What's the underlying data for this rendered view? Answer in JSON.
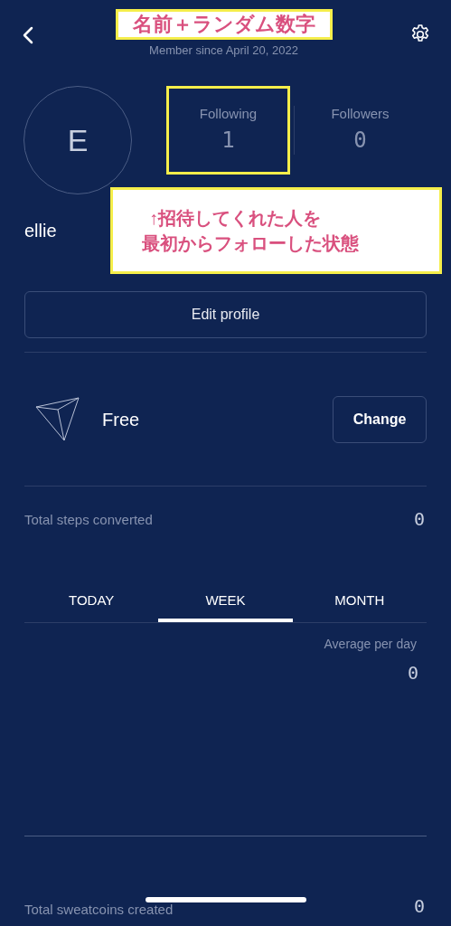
{
  "header": {
    "title_annotation": "名前＋ランダム数字",
    "member_since": "Member since April 20, 2022"
  },
  "profile": {
    "avatar_initial": "E",
    "name": "ellie"
  },
  "stats": [
    {
      "label": "Following",
      "value": "1",
      "highlighted": true
    },
    {
      "label": "Followers",
      "value": "0",
      "highlighted": false
    }
  ],
  "note_annotation": [
    "↑招待してくれた人を",
    "最初からフォローした状態"
  ],
  "edit_button": "Edit profile",
  "plan": {
    "name": "Free",
    "button": "Change"
  },
  "total_steps": {
    "label": "Total steps converted",
    "value": "0"
  },
  "tabs": [
    {
      "label": "TODAY",
      "selected": false
    },
    {
      "label": "WEEK",
      "selected": true
    },
    {
      "label": "MONTH",
      "selected": false
    }
  ],
  "average": {
    "label": "Average per day",
    "value": "0"
  },
  "total_sweatcoins": {
    "label": "Total sweatcoins created",
    "value": "0"
  }
}
